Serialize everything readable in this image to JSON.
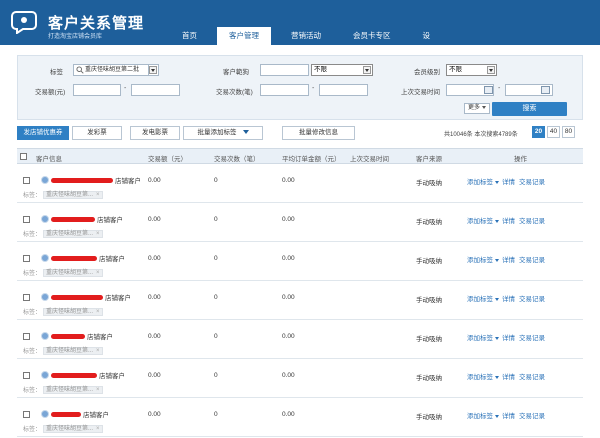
{
  "header": {
    "title": "客户关系管理",
    "subtitle": "打造淘宝店铺会员库",
    "nav": [
      {
        "label": "首页",
        "active": false
      },
      {
        "label": "客户管理",
        "active": true
      },
      {
        "label": "营销活动",
        "active": false
      },
      {
        "label": "会员卡专区",
        "active": false
      },
      {
        "label": "设",
        "active": false
      }
    ]
  },
  "filters": {
    "tag_label": "标签",
    "tag_value": "重庆怪味胡豆第二批",
    "range_label": "客户範狗",
    "range_value": "",
    "range_select": "不限",
    "level_label": "会员级别",
    "level_select": "不限",
    "amount_label": "交易额(元)",
    "count_label": "交易次数(笔)",
    "last_label": "上次交易时间",
    "dash": "-",
    "more_label": "更多",
    "search_label": "搜索"
  },
  "actions": {
    "coupon": "发店铺优惠券",
    "sms": "发彩票",
    "email": "发电影票",
    "batch_tag": "批量添加标签",
    "batch_edit": "批量修改信息",
    "count_text": "共10046条 本次搜索4789条",
    "page_sizes": [
      {
        "label": "20",
        "active": true
      },
      {
        "label": "40",
        "active": false
      },
      {
        "label": "80",
        "active": false
      }
    ]
  },
  "columns": {
    "info": "客户信息",
    "amount": "交易额（元）",
    "count": "交易次数（笔）",
    "avg": "平均订单金额（元）",
    "last": "上次交易时间",
    "source": "客户来源",
    "ops": "操作"
  },
  "row_labels": {
    "tag_prefix": "标签：",
    "chip": "重庆怪味胡豆第...",
    "chip_close": "×",
    "add_tag": "添加标签",
    "detail": "详情",
    "history": "交易记录"
  },
  "rows": [
    {
      "name": "店铺客户",
      "amount": "0.00",
      "count": "0",
      "avg": "0.00",
      "source": "手动吸纳"
    },
    {
      "name": "店铺客户",
      "amount": "0.00",
      "count": "0",
      "avg": "0.00",
      "source": "手动吸纳"
    },
    {
      "name": "店铺客户",
      "amount": "0.00",
      "count": "0",
      "avg": "0.00",
      "source": "手动吸纳"
    },
    {
      "name": "店铺客户",
      "amount": "0.00",
      "count": "0",
      "avg": "0.00",
      "source": "手动吸纳"
    },
    {
      "name": "店铺客户",
      "amount": "0.00",
      "count": "0",
      "avg": "0.00",
      "source": "手动吸纳"
    },
    {
      "name": "店铺客户",
      "amount": "0.00",
      "count": "0",
      "avg": "0.00",
      "source": "手动吸纳"
    },
    {
      "name": "店铺客户",
      "amount": "0.00",
      "count": "0",
      "avg": "0.00",
      "source": "手动吸纳"
    }
  ],
  "colors": {
    "header": "#1e5f9b",
    "accent": "#2f80c4",
    "link": "#2a72b8",
    "redaction": "#e21d1d"
  }
}
